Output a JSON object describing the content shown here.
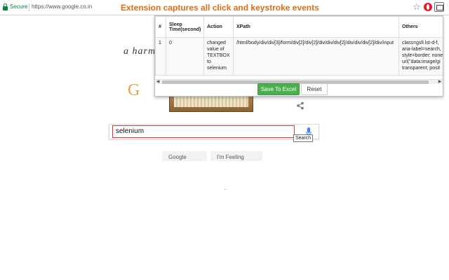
{
  "browser": {
    "security_label": "Secure",
    "url": "https://www.google.co.in",
    "banner": "Extension captures all click and keystroke events",
    "icons": [
      "lock-icon",
      "star-icon",
      "opera-icon",
      "extension-icon"
    ]
  },
  "google": {
    "doodle_text": "a harm",
    "doodle_letters": "G O",
    "search_value": "selenium",
    "search_tooltip": "Search",
    "buttons": [
      "Google Search",
      "I'm Feeling Lucky"
    ]
  },
  "popup": {
    "columns": [
      "#",
      "Sleep Time(second)",
      "Action",
      "XPath",
      "Others"
    ],
    "rows": [
      {
        "index": "1",
        "sleep": "0",
        "action": "changed value of TEXTBOX to selenium",
        "xpath": "/html/body/div/div[3]/form/div[2]/div[2]/div/div/div[2]/div/div/div[2]/div/input",
        "others": "class=gsfi lst-d-f, aria-label=search, style=border: none; url(\"data:image/gi transparent; posit"
      }
    ],
    "save_label": "Save To Excel",
    "reset_label": "Reset"
  },
  "colors": {
    "banner": "#e06c15",
    "save_button": "#4cae4c",
    "secure": "#0b8043",
    "search_outline": "#e53935"
  }
}
